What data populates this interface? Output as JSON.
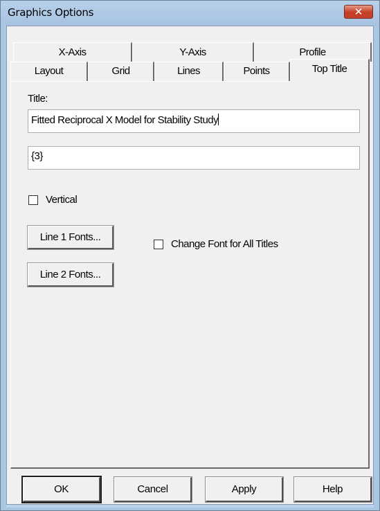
{
  "window": {
    "title": "Graphics Options",
    "close_glyph": "✕"
  },
  "tabs": {
    "row_back": [
      {
        "label": "X-Axis"
      },
      {
        "label": "Y-Axis"
      },
      {
        "label": "Profile"
      }
    ],
    "row_front": [
      {
        "label": "Layout"
      },
      {
        "label": "Grid"
      },
      {
        "label": "Lines"
      },
      {
        "label": "Points"
      },
      {
        "label": "Top Title"
      }
    ],
    "active": "Top Title"
  },
  "top_title": {
    "title_label": "Title:",
    "line1_value": "Fitted Reciprocal X Model for Stability Study",
    "line2_value": "{3}",
    "vertical_label": "Vertical",
    "vertical_checked": false,
    "line1_fonts_label": "Line 1 Fonts...",
    "line2_fonts_label": "Line 2 Fonts...",
    "change_font_all_label": "Change Font for All Titles",
    "change_font_all_checked": false
  },
  "buttons": {
    "ok": "OK",
    "cancel": "Cancel",
    "apply": "Apply",
    "help": "Help"
  },
  "colors": {
    "title_bar": "#a9c6e3",
    "close_button": "#c63c23",
    "dialog_face": "#f0f0f0"
  }
}
